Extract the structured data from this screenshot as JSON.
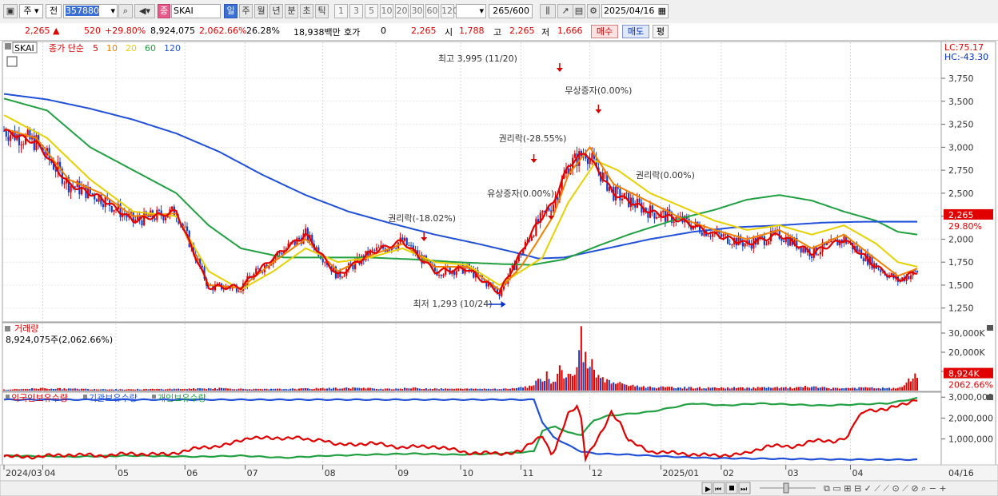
{
  "toolbar": {
    "market": "주",
    "prev_label": "전",
    "code": "357880",
    "type_badge": "종",
    "stock_name": "SKAI",
    "periods": [
      "일",
      "주",
      "월",
      "년",
      "분",
      "초",
      "틱"
    ],
    "active_period": "일",
    "intervals": [
      "1",
      "3",
      "5",
      "10",
      "20",
      "30",
      "60",
      "120"
    ],
    "count": "265",
    "count_max": "/600",
    "date": "2025/04/16"
  },
  "quote": {
    "price": "2,265",
    "change": "520",
    "change_pct": "+29.80%",
    "volume": "8,924,075",
    "volume_pct": "2,062.66%",
    "turnover_pct": "26.28%",
    "amount": "18,938백만",
    "hoga_label": "호가",
    "hoga_value": "0",
    "hoga_price": "2,265",
    "open_label": "시",
    "open": "1,788",
    "high_label": "고",
    "high": "2,265",
    "low_label": "저",
    "low": "1,666",
    "buy_label": "매수",
    "sell_label": "매도",
    "avg_label": "평"
  },
  "chart_data": [
    {
      "type": "candlestick",
      "legend_name": "SKAI",
      "ma_label": "종가 단순",
      "ma_periods": [
        5,
        10,
        20,
        60,
        120
      ],
      "ma_colors": [
        "#e00000",
        "#f08000",
        "#e6d000",
        "#20a040",
        "#2050d8"
      ],
      "ylim": [
        1100,
        4150
      ],
      "y_ticks": [
        1250,
        1500,
        1750,
        2000,
        2250,
        2500,
        2750,
        3000,
        3250,
        3500,
        3750
      ],
      "y_tick_labels": [
        "1,250",
        "1,500",
        "1,750",
        "2,000",
        "2,250",
        "2,500",
        "2,750",
        "3,000",
        "3,250",
        "3,500",
        "3,750"
      ],
      "corner_lc": "LC:75.17",
      "corner_hc": "HC:-43.30",
      "current_price_label": "2,265",
      "current_change_label": "29.80%",
      "ma_anchors": {
        "ma5": [
          [
            0,
            3180
          ],
          [
            15,
            3050
          ],
          [
            30,
            2600
          ],
          [
            45,
            2450
          ],
          [
            60,
            2200
          ],
          [
            80,
            2300
          ],
          [
            95,
            1480
          ],
          [
            110,
            1480
          ],
          [
            125,
            1800
          ],
          [
            140,
            2050
          ],
          [
            155,
            1600
          ],
          [
            170,
            1850
          ],
          [
            185,
            1980
          ],
          [
            200,
            1650
          ],
          [
            215,
            1680
          ],
          [
            230,
            1420
          ],
          [
            240,
            1850
          ],
          [
            247,
            2150
          ],
          [
            255,
            2400
          ],
          [
            262,
            2800
          ],
          [
            270,
            2950
          ],
          [
            283,
            2500
          ],
          [
            300,
            2300
          ],
          [
            315,
            2200
          ],
          [
            330,
            2050
          ],
          [
            345,
            1950
          ],
          [
            360,
            2050
          ],
          [
            375,
            1850
          ],
          [
            390,
            2000
          ],
          [
            405,
            1700
          ],
          [
            415,
            1550
          ],
          [
            424,
            1650
          ]
        ],
        "ma10": [
          [
            0,
            3200
          ],
          [
            15,
            3100
          ],
          [
            30,
            2650
          ],
          [
            45,
            2500
          ],
          [
            60,
            2250
          ],
          [
            80,
            2280
          ],
          [
            95,
            1500
          ],
          [
            110,
            1470
          ],
          [
            125,
            1750
          ],
          [
            140,
            2000
          ],
          [
            155,
            1650
          ],
          [
            170,
            1820
          ],
          [
            185,
            1950
          ],
          [
            200,
            1700
          ],
          [
            215,
            1700
          ],
          [
            230,
            1450
          ],
          [
            240,
            1700
          ],
          [
            247,
            1950
          ],
          [
            255,
            2250
          ],
          [
            262,
            2700
          ],
          [
            272,
            3000
          ],
          [
            283,
            2600
          ],
          [
            300,
            2400
          ],
          [
            315,
            2220
          ],
          [
            330,
            2100
          ],
          [
            345,
            2000
          ],
          [
            360,
            2100
          ],
          [
            375,
            1900
          ],
          [
            390,
            2050
          ],
          [
            405,
            1780
          ],
          [
            415,
            1600
          ],
          [
            424,
            1680
          ]
        ],
        "ma20": [
          [
            0,
            3350
          ],
          [
            20,
            3100
          ],
          [
            40,
            2650
          ],
          [
            60,
            2300
          ],
          [
            80,
            2250
          ],
          [
            95,
            1650
          ],
          [
            110,
            1450
          ],
          [
            125,
            1650
          ],
          [
            140,
            1900
          ],
          [
            155,
            1750
          ],
          [
            170,
            1800
          ],
          [
            185,
            1900
          ],
          [
            200,
            1750
          ],
          [
            215,
            1720
          ],
          [
            230,
            1500
          ],
          [
            240,
            1650
          ],
          [
            250,
            1800
          ],
          [
            262,
            2400
          ],
          [
            275,
            2850
          ],
          [
            285,
            2750
          ],
          [
            300,
            2500
          ],
          [
            315,
            2350
          ],
          [
            330,
            2200
          ],
          [
            345,
            2100
          ],
          [
            360,
            2150
          ],
          [
            375,
            2050
          ],
          [
            390,
            2150
          ],
          [
            405,
            1950
          ],
          [
            415,
            1750
          ],
          [
            424,
            1700
          ]
        ],
        "ma60": [
          [
            0,
            3530
          ],
          [
            20,
            3400
          ],
          [
            40,
            3000
          ],
          [
            60,
            2750
          ],
          [
            80,
            2500
          ],
          [
            95,
            2150
          ],
          [
            110,
            1900
          ],
          [
            130,
            1800
          ],
          [
            150,
            1800
          ],
          [
            170,
            1800
          ],
          [
            190,
            1780
          ],
          [
            210,
            1750
          ],
          [
            230,
            1730
          ],
          [
            245,
            1720
          ],
          [
            260,
            1780
          ],
          [
            275,
            1920
          ],
          [
            290,
            2050
          ],
          [
            310,
            2200
          ],
          [
            330,
            2320
          ],
          [
            345,
            2430
          ],
          [
            360,
            2480
          ],
          [
            375,
            2420
          ],
          [
            390,
            2300
          ],
          [
            405,
            2200
          ],
          [
            415,
            2080
          ],
          [
            424,
            2050
          ]
        ],
        "ma120": [
          [
            0,
            3580
          ],
          [
            20,
            3520
          ],
          [
            40,
            3420
          ],
          [
            60,
            3300
          ],
          [
            80,
            3150
          ],
          [
            100,
            2950
          ],
          [
            120,
            2700
          ],
          [
            140,
            2480
          ],
          [
            160,
            2300
          ],
          [
            180,
            2170
          ],
          [
            200,
            2050
          ],
          [
            220,
            1950
          ],
          [
            240,
            1840
          ],
          [
            248,
            1790
          ],
          [
            260,
            1800
          ],
          [
            280,
            1900
          ],
          [
            300,
            2000
          ],
          [
            320,
            2080
          ],
          [
            340,
            2130
          ],
          [
            360,
            2150
          ],
          [
            380,
            2180
          ],
          [
            400,
            2190
          ],
          [
            424,
            2190
          ]
        ]
      },
      "annotations": [
        {
          "text": "최고 3,995 (11/20)",
          "index": 258
        },
        {
          "text": "무상증자(0.00%)",
          "index": 276
        },
        {
          "text": "권리락(-28.55%)",
          "index": 246
        },
        {
          "text": "유상증자(0.00%)",
          "index": 254
        },
        {
          "text": "권리락(-18.02%)",
          "index": 195
        },
        {
          "text": "권리락(0.00%)",
          "index": 300
        },
        {
          "text": "최저 1,293 (10/24)",
          "index": 233
        }
      ],
      "x_labels": [
        "2024/03",
        "04",
        "05",
        "06",
        "07",
        "08",
        "09",
        "10",
        "11",
        "12",
        "2025/01",
        "02",
        "03",
        "04"
      ],
      "x_label_index": [
        0,
        18,
        52,
        84,
        112,
        148,
        182,
        212,
        240,
        272,
        305,
        333,
        363,
        393
      ],
      "x_end_label": "04/16"
    },
    {
      "type": "bar",
      "name": "거래량",
      "info": "8,924,075주(2,062.66%)",
      "ylim": [
        0,
        35000
      ],
      "y_ticks": [
        10000,
        20000,
        30000
      ],
      "y_tick_labels": [
        "10,000K",
        "20,000K",
        "30,000K"
      ],
      "current_label": "8,924K",
      "current_pct_label": "2062.66%",
      "spikes": [
        [
          0,
          600
        ],
        [
          18,
          1500
        ],
        [
          28,
          1200
        ],
        [
          58,
          800
        ],
        [
          88,
          1200
        ],
        [
          100,
          1500
        ],
        [
          116,
          900
        ],
        [
          128,
          1000
        ],
        [
          148,
          1400
        ],
        [
          162,
          1700
        ],
        [
          178,
          1100
        ],
        [
          190,
          1600
        ],
        [
          200,
          1200
        ],
        [
          215,
          1100
        ],
        [
          236,
          1300
        ],
        [
          244,
          2600
        ],
        [
          248,
          6200
        ],
        [
          252,
          10000
        ],
        [
          255,
          4600
        ],
        [
          258,
          13200
        ],
        [
          262,
          8800
        ],
        [
          266,
          12200
        ],
        [
          268,
          33600
        ],
        [
          270,
          20200
        ],
        [
          273,
          16400
        ],
        [
          276,
          8200
        ],
        [
          280,
          6000
        ],
        [
          286,
          4500
        ],
        [
          292,
          3000
        ],
        [
          300,
          2200
        ],
        [
          310,
          2000
        ],
        [
          330,
          1700
        ],
        [
          350,
          1900
        ],
        [
          368,
          1800
        ],
        [
          372,
          2500
        ],
        [
          385,
          1500
        ],
        [
          400,
          1800
        ],
        [
          415,
          1400
        ],
        [
          423,
          8924
        ]
      ]
    },
    {
      "type": "line",
      "series_names": [
        "외국인보유수량",
        "기관보유수량",
        "개인보유수량"
      ],
      "series_colors": [
        "#e00000",
        "#2050d8",
        "#20a040"
      ],
      "ylim": [
        -200000,
        3200000
      ],
      "y_ticks": [
        1000000,
        2000000,
        3000000
      ],
      "y_tick_labels": [
        "1,000,000",
        "2,000,000",
        "3,000,000"
      ],
      "anchors": {
        "foreign": [
          [
            0,
            150000
          ],
          [
            15,
            150000
          ],
          [
            30,
            250000
          ],
          [
            45,
            200000
          ],
          [
            60,
            300000
          ],
          [
            75,
            250000
          ],
          [
            90,
            550000
          ],
          [
            105,
            750000
          ],
          [
            115,
            1100000
          ],
          [
            125,
            1000000
          ],
          [
            135,
            1100000
          ],
          [
            142,
            900000
          ],
          [
            148,
            1000000
          ],
          [
            155,
            700000
          ],
          [
            170,
            800000
          ],
          [
            185,
            600000
          ],
          [
            200,
            650000
          ],
          [
            215,
            350000
          ],
          [
            230,
            300000
          ],
          [
            240,
            400000
          ],
          [
            246,
            900000
          ],
          [
            250,
            1200000
          ],
          [
            254,
            300000
          ],
          [
            256,
            500000
          ],
          [
            262,
            2200000
          ],
          [
            266,
            2600000
          ],
          [
            268,
            2000000
          ],
          [
            270,
            100000
          ],
          [
            274,
            700000
          ],
          [
            278,
            1400000
          ],
          [
            282,
            2300000
          ],
          [
            286,
            1800000
          ],
          [
            290,
            900000
          ],
          [
            300,
            400000
          ],
          [
            315,
            300000
          ],
          [
            330,
            200000
          ],
          [
            345,
            300000
          ],
          [
            355,
            700000
          ],
          [
            365,
            600000
          ],
          [
            375,
            900000
          ],
          [
            385,
            900000
          ],
          [
            392,
            1100000
          ],
          [
            395,
            1800000
          ],
          [
            400,
            2400000
          ],
          [
            410,
            2400000
          ],
          [
            418,
            2700000
          ],
          [
            424,
            2900000
          ]
        ],
        "institution": [
          [
            0,
            2880000
          ],
          [
            200,
            2880000
          ],
          [
            246,
            2880000
          ],
          [
            250,
            1800000
          ],
          [
            255,
            1100000
          ],
          [
            262,
            700000
          ],
          [
            268,
            400000
          ],
          [
            275,
            300000
          ],
          [
            290,
            250000
          ],
          [
            310,
            150000
          ],
          [
            330,
            80000
          ],
          [
            360,
            50000
          ],
          [
            390,
            20000
          ],
          [
            424,
            10000
          ]
        ],
        "individual": [
          [
            0,
            200000
          ],
          [
            30,
            150000
          ],
          [
            60,
            200000
          ],
          [
            90,
            150000
          ],
          [
            110,
            200000
          ],
          [
            130,
            100000
          ],
          [
            150,
            200000
          ],
          [
            170,
            250000
          ],
          [
            190,
            300000
          ],
          [
            210,
            250000
          ],
          [
            230,
            300000
          ],
          [
            246,
            400000
          ],
          [
            250,
            1400000
          ],
          [
            256,
            1600000
          ],
          [
            262,
            1300000
          ],
          [
            268,
            1200000
          ],
          [
            274,
            1900000
          ],
          [
            280,
            2100000
          ],
          [
            290,
            2200000
          ],
          [
            300,
            2300000
          ],
          [
            310,
            2500000
          ],
          [
            320,
            2700000
          ],
          [
            335,
            2600000
          ],
          [
            350,
            2700000
          ],
          [
            365,
            2650000
          ],
          [
            380,
            2600000
          ],
          [
            395,
            2650000
          ],
          [
            410,
            2700000
          ],
          [
            424,
            2950000
          ]
        ]
      }
    }
  ]
}
